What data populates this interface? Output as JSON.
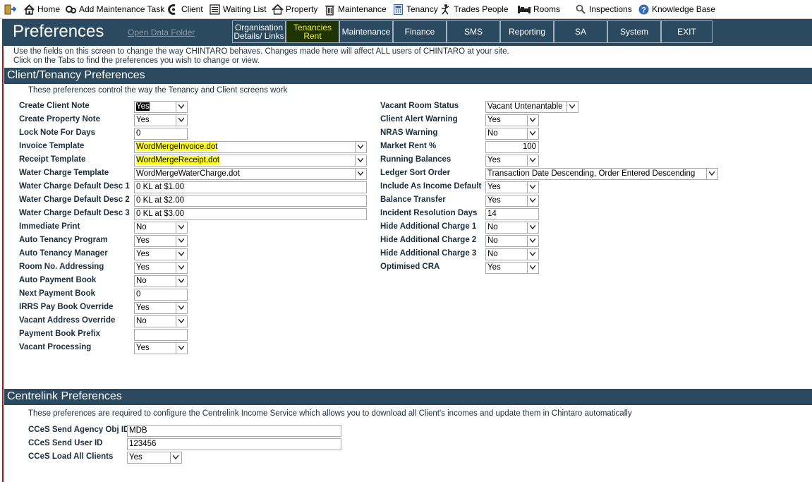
{
  "toolbar": {
    "items": [
      {
        "label": "",
        "icon": "exit-door-icon"
      },
      {
        "label": "Home",
        "icon": "home-icon"
      },
      {
        "label": "Add Maintenance Task",
        "icon": "gear-icon"
      },
      {
        "label": "Client",
        "icon": "client-icon"
      },
      {
        "label": "Waiting List",
        "icon": "list-icon"
      },
      {
        "label": "Property",
        "icon": "property-icon"
      },
      {
        "label": "Maintenance",
        "icon": "trash-icon"
      },
      {
        "label": "Tenancy",
        "icon": "calculator-icon"
      },
      {
        "label": "Trades People",
        "icon": "trades-icon"
      },
      {
        "label": "Rooms",
        "icon": "bed-icon"
      },
      {
        "label": "Inspections",
        "icon": "search-icon"
      },
      {
        "label": "Knowledge Base",
        "icon": "help-icon"
      }
    ]
  },
  "header": {
    "title": "Preferences",
    "open_data_folder": "Open Data Folder",
    "tabs": [
      {
        "line1": "Organisation",
        "line2": "Details/ Links",
        "active": false
      },
      {
        "line1": "Tenancies",
        "line2": "Rent",
        "active": true
      },
      {
        "line1": "Maintenance",
        "line2": "",
        "active": false
      },
      {
        "line1": "Finance",
        "line2": "",
        "active": false
      },
      {
        "line1": "SMS",
        "line2": "",
        "active": false
      },
      {
        "line1": "Reporting",
        "line2": "",
        "active": false
      },
      {
        "line1": "SA",
        "line2": "",
        "active": false
      },
      {
        "line1": "System",
        "line2": "",
        "active": false
      },
      {
        "line1": "EXIT",
        "line2": "",
        "active": false
      }
    ]
  },
  "intro": {
    "line1": "Use the fields on this screen to change the way CHINTARO behaves.  Changes made here will affect ALL users of CHINTARO at your site.",
    "line2": "Click on the Tabs to find the preferences you wish to change or view."
  },
  "client_tenancy": {
    "title": "Client/Tenancy Preferences",
    "description": "These preferences control the way the Tenancy and Client screens work",
    "left_fields": [
      {
        "label": "Create Client Note",
        "value": "Yes",
        "type": "select"
      },
      {
        "label": "Create Property Note",
        "value": "Yes",
        "type": "select"
      },
      {
        "label": "Lock Note For Days",
        "value": "0",
        "type": "text"
      },
      {
        "label": "Invoice Template",
        "value": "WordMergeInvoice.dot",
        "type": "select-wide"
      },
      {
        "label": "Receipt Template",
        "value": "WordMergeReceipt.dot",
        "type": "select-wide"
      },
      {
        "label": "Water Charge Template",
        "value": "WordMergeWaterCharge.dot",
        "type": "select-wide"
      },
      {
        "label": "Water Charge Default Desc 1",
        "value": "0 KL at $1.00",
        "type": "text-wide"
      },
      {
        "label": "Water Charge Default Desc 2",
        "value": "0 KL at $2.00",
        "type": "text-wide"
      },
      {
        "label": "Water Charge Default Desc 3",
        "value": "0 KL at $3.00",
        "type": "text-wide"
      },
      {
        "label": "Immediate Print",
        "value": "No",
        "type": "select"
      },
      {
        "label": "Auto Tenancy Program",
        "value": "Yes",
        "type": "select"
      },
      {
        "label": "Auto Tenancy Manager",
        "value": "Yes",
        "type": "select"
      },
      {
        "label": "Room No. Addressing",
        "value": "Yes",
        "type": "select"
      },
      {
        "label": "Auto Payment Book",
        "value": "No",
        "type": "select"
      },
      {
        "label": "Next Payment Book",
        "value": "0",
        "type": "text"
      },
      {
        "label": "IRRS Pay Book Override",
        "value": "Yes",
        "type": "select"
      },
      {
        "label": "Vacant Address Override",
        "value": "No",
        "type": "select"
      },
      {
        "label": "Payment Book Prefix",
        "value": "",
        "type": "text"
      },
      {
        "label": "Vacant Processing",
        "value": "Yes",
        "type": "select"
      }
    ],
    "right_fields": [
      {
        "label": "Vacant Room Status",
        "value": "Vacant Untenantable",
        "type": "select-mid"
      },
      {
        "label": "Client Alert Warning",
        "value": "Yes",
        "type": "select"
      },
      {
        "label": "NRAS Warning",
        "value": "No",
        "type": "select"
      },
      {
        "label": "Market Rent %",
        "value": "100",
        "type": "number"
      },
      {
        "label": "Running Balances",
        "value": "Yes",
        "type": "select"
      },
      {
        "label": "Ledger Sort Order",
        "value": "Transaction Date Descending, Order Entered Descending",
        "type": "select-wide"
      },
      {
        "label": "Include As Income Default",
        "value": "Yes",
        "type": "select"
      },
      {
        "label": "Balance Transfer",
        "value": "Yes",
        "type": "select"
      },
      {
        "label": "Incident Resolution Days",
        "value": "14",
        "type": "text"
      },
      {
        "label": "Hide Additional Charge 1",
        "value": "No",
        "type": "select"
      },
      {
        "label": "Hide Additional Charge 2",
        "value": "No",
        "type": "select"
      },
      {
        "label": "Hide Additional Charge 3",
        "value": "No",
        "type": "select"
      },
      {
        "label": "Optimised CRA",
        "value": "Yes",
        "type": "select"
      }
    ]
  },
  "centrelink": {
    "title": "Centrelink Preferences",
    "description": "These preferences are required to configure the Centrelink Income Service which allows you to download all Client's incomes and update them in Chintaro automatically",
    "fields": [
      {
        "label": "CCeS Send Agency Obj ID",
        "value": "MDB",
        "type": "text"
      },
      {
        "label": "CCeS Send User ID",
        "value": "123456",
        "type": "text"
      },
      {
        "label": "CCeS Load All Clients",
        "value": "Yes",
        "type": "select"
      }
    ]
  },
  "colors": {
    "header_bg": "#2c4a5f",
    "active_tab_bg": "#1e3300",
    "active_tab_text": "#f2f200",
    "highlight": "#ffff1a"
  }
}
